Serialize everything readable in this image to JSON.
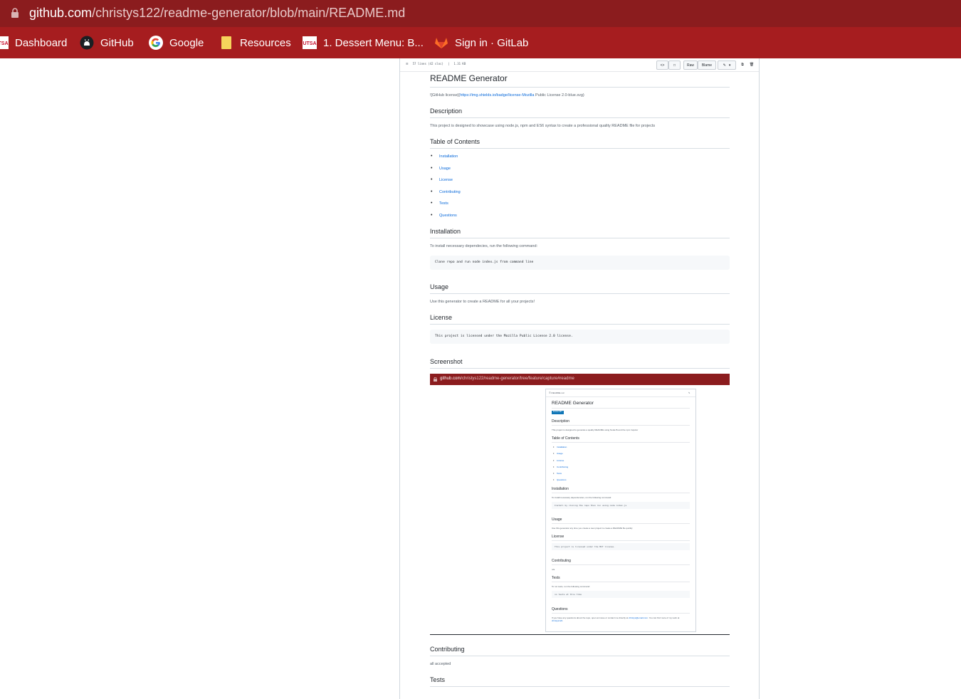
{
  "browser": {
    "url_host": "github.com",
    "url_path": "/christys122/readme-generator/blob/main/README.md",
    "bookmarks": [
      {
        "label": "Dashboard",
        "icon": "utsa-logo-icon"
      },
      {
        "label": "GitHub",
        "icon": "github-icon"
      },
      {
        "label": "Google",
        "icon": "google-icon"
      },
      {
        "label": "Resources",
        "icon": "folder-icon"
      },
      {
        "label": "1. Dessert Menu: B...",
        "icon": "utsa-logo-icon"
      },
      {
        "label": "Sign in · GitLab",
        "icon": "gitlab-icon"
      }
    ]
  },
  "file_toolbar": {
    "lines_info": "57 lines (42 sloc)",
    "size": "1.31 KB",
    "raw_label": "Raw",
    "blame_label": "Blame"
  },
  "readme": {
    "title": "README Generator",
    "badge_prefix": "![GitHub license](",
    "badge_link": "https://img.shields.io/badge/license-Mozilla",
    "badge_suffix": " Public License 2.0-blue.svg)",
    "description_heading": "Description",
    "description_text": "This project is designed to showcase using node.js, npm and ES6 syntax to create a professional quality README file for projects",
    "toc_heading": "Table of Contents",
    "toc": [
      "Installation",
      "Usage",
      "License",
      "Contributing",
      "Tests",
      "Questions"
    ],
    "installation_heading": "Installation",
    "installation_text": "To install necessary dependecies, run the following command:",
    "installation_code": "Clone repo and run node index.js from command line",
    "usage_heading": "Usage",
    "usage_text": "Use this generator to create a README for all your projects!",
    "license_heading": "License",
    "license_code": "This project is licensed under the Mozilla Public License 2.0 license.",
    "screenshot_heading": "Screenshot",
    "contributing_heading": "Contributing",
    "contributing_text": "all accepted",
    "tests_heading": "Tests"
  },
  "screenshot": {
    "url_host": "github.com",
    "url_path": "/christys122/readme-generator/tree/feature/capture#readme",
    "file_label": "README.md",
    "title": "README Generator",
    "badge": "license MIT",
    "description_heading": "Description",
    "description_text": "This project is designed to generate a quality README using NodeJS and the npm Inquirer",
    "toc_heading": "Table of Contents",
    "toc": [
      "Installation",
      "Usage",
      "License",
      "Contributing",
      "Tests",
      "Questions"
    ],
    "installation_heading": "Installation",
    "installation_text": "To install necessary dependencies, run the following command:",
    "installation_code": "Install by cloning the repo then run using node index.js",
    "usage_heading": "Usage",
    "usage_text": "Use this generator any time you create a new project to create a README file quickly",
    "license_heading": "License",
    "license_code": "This project is licensed under the MIT license.",
    "contributing_heading": "Contributing",
    "contributing_text": "n/a",
    "tests_heading": "Tests",
    "tests_text": "To run tests, run the following command:",
    "tests_code": "no tests at this time",
    "questions_heading": "Questions",
    "questions_prefix": "If you have any questions about the repo, open an issue or contact me directly at ",
    "questions_email": "christys@email.com",
    "questions_mid": ". You can find more of my work at ",
    "questions_user": "christys122",
    "questions_end": "."
  }
}
